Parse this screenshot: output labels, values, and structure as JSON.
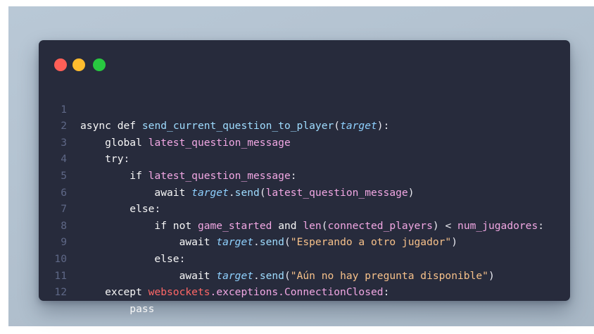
{
  "window_controls": {
    "close_color": "#ff5f57",
    "minimize_color": "#febc2e",
    "maximize_color": "#28c840"
  },
  "code": {
    "language": "python",
    "lines": [
      {
        "number": "1",
        "parts": [
          "async",
          " ",
          "def",
          " ",
          "send_current_question_to_player",
          "(",
          "target",
          "):"
        ]
      },
      {
        "number": "2",
        "parts": [
          "global",
          " ",
          "latest_question_message"
        ]
      },
      {
        "number": "3",
        "parts": [
          "try",
          ":"
        ]
      },
      {
        "number": "4",
        "parts": [
          "if",
          " ",
          "latest_question_message",
          ":"
        ]
      },
      {
        "number": "5",
        "parts": [
          "await",
          " ",
          "target",
          ".",
          "send",
          "(",
          "latest_question_message",
          ")"
        ]
      },
      {
        "number": "6",
        "parts": [
          "else",
          ":"
        ]
      },
      {
        "number": "7",
        "parts": [
          "if",
          " ",
          "not",
          " ",
          "game_started",
          " ",
          "and",
          " ",
          "len",
          "(",
          "connected_players",
          ") < ",
          "num_jugadores",
          ":"
        ]
      },
      {
        "number": "8",
        "parts": [
          "await",
          " ",
          "target",
          ".",
          "send",
          "(",
          "\"Esperando a otro jugador\"",
          ")"
        ]
      },
      {
        "number": "9",
        "parts": [
          "else",
          ":"
        ]
      },
      {
        "number": "10",
        "parts": [
          "await",
          " ",
          "target",
          ".",
          "send",
          "(",
          "\"Aún no hay pregunta disponible\"",
          ")"
        ]
      },
      {
        "number": "11",
        "parts": [
          "except",
          " ",
          "websockets",
          ".exceptions.",
          "ConnectionClosed",
          ":"
        ]
      },
      {
        "number": "12",
        "parts": [
          "pass"
        ]
      }
    ]
  }
}
